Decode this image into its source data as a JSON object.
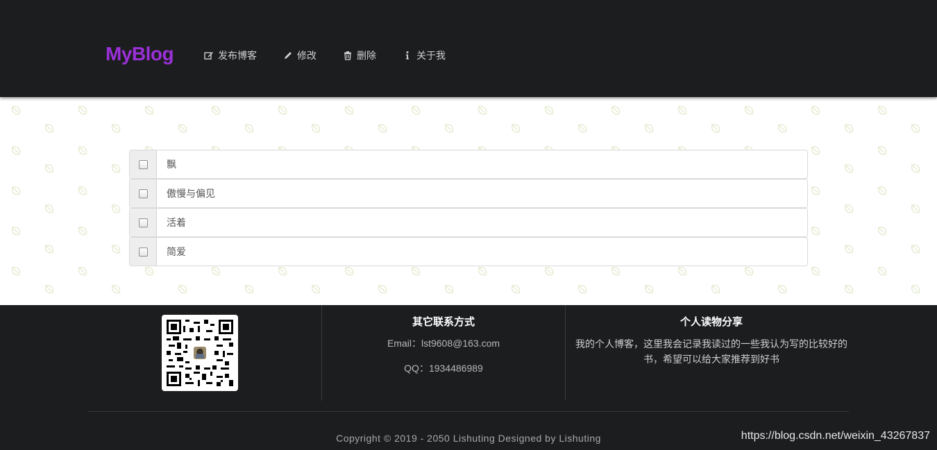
{
  "header": {
    "brand": "MyBlog",
    "brand_color": "#9b30d9",
    "nav": [
      {
        "label": "发布博客",
        "icon": "edit-icon"
      },
      {
        "label": "修改",
        "icon": "pencil-icon"
      },
      {
        "label": "删除",
        "icon": "trash-icon"
      },
      {
        "label": "关于我",
        "icon": "info-icon"
      }
    ]
  },
  "main": {
    "items": [
      {
        "title": "飘",
        "checked": false
      },
      {
        "title": "傲慢与偏见",
        "checked": false
      },
      {
        "title": "活着",
        "checked": false
      },
      {
        "title": "简爱",
        "checked": false
      }
    ]
  },
  "footer": {
    "contact": {
      "title": "其它联系方式",
      "email": "Email：lst9608@163.com",
      "qq": "QQ：1934486989"
    },
    "share": {
      "title": "个人读物分享",
      "text": "我的个人博客，这里我会记录我读过的一些我认为写的比较好的书，希望可以给大家推荐到好书"
    },
    "copyright": "Copyright © 2019 - 2050 Lishuting Designed by Lishuting",
    "watermark": "https://blog.csdn.net/weixin_43267837"
  }
}
